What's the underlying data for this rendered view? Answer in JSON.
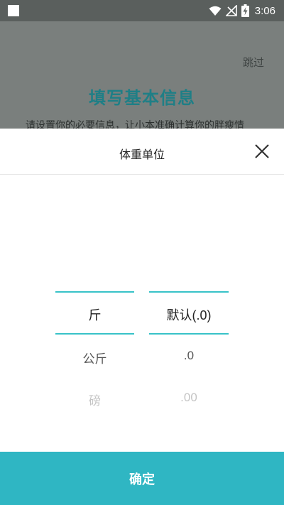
{
  "status_bar": {
    "time": "3:06"
  },
  "background": {
    "skip_label": "跳过",
    "title": "填写基本信息",
    "description": "请设置你的必要信息，让小本准确计算你的胖瘦情况，提供更好的瘦身体验。"
  },
  "sheet": {
    "title": "体重单位",
    "unit_column": [
      "斤",
      "公斤",
      "磅"
    ],
    "decimal_column": [
      "默认(.0)",
      ".0",
      ".00"
    ],
    "selected_unit": "斤",
    "selected_decimal": "默认(.0)",
    "confirm_label": "确定"
  },
  "colors": {
    "accent": "#2fb6c3",
    "picker_line": "#38c2c8",
    "title_teal": "#1f7f86"
  }
}
